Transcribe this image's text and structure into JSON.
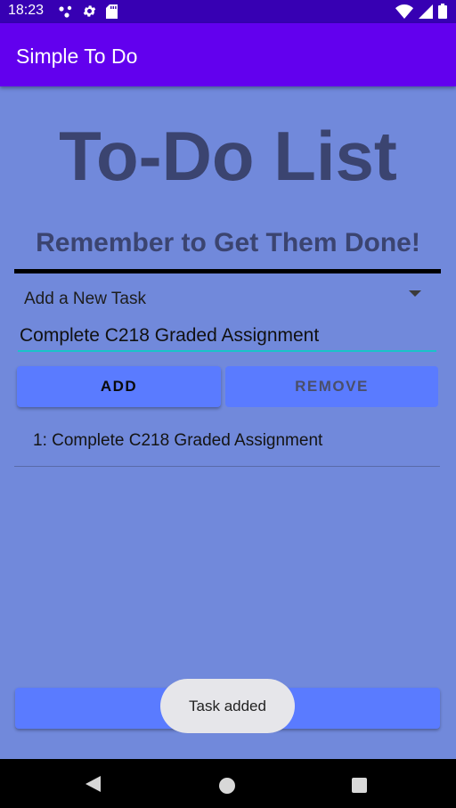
{
  "status_bar": {
    "time": "18:23",
    "left_icons": [
      "notification-dots-icon",
      "settings-gear-icon",
      "sd-card-icon"
    ],
    "right_icons": [
      "wifi-icon",
      "cell-signal-icon",
      "battery-icon"
    ]
  },
  "app_bar": {
    "title": "Simple To Do"
  },
  "header": {
    "title": "To-Do List",
    "subtitle": "Remember to Get Them Done!"
  },
  "spinner": {
    "selected": "Add a New Task"
  },
  "task_input": {
    "value": "Complete C218 Graded Assignment"
  },
  "buttons": {
    "add_label": "ADD",
    "remove_label": "REMOVE",
    "remove_enabled": false
  },
  "tasks": [
    {
      "label": "1: Complete C218 Graded Assignment"
    }
  ],
  "toast": {
    "message": "Task added"
  },
  "nav_bar": {
    "icons": [
      "back-icon",
      "home-icon",
      "recents-icon"
    ]
  },
  "colors": {
    "status_bar": "#3700b3",
    "app_bar": "#6200ee",
    "background": "#7189db",
    "title_text": "#3b4470",
    "button": "#5a7bff",
    "input_underline": "#18c3c9",
    "toast_bg": "#e6e6ea"
  }
}
